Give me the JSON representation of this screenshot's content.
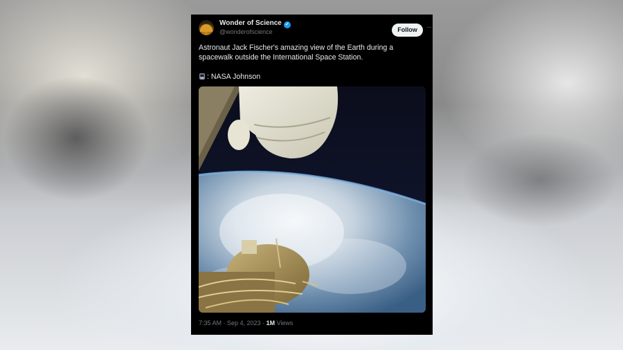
{
  "post": {
    "author_name": "Wonder of Science",
    "author_handle": "@wonderofscience",
    "follow_label": "Follow",
    "more_icon": "ellipsis-icon",
    "verified_icon": "verified-badge-icon",
    "text": "Astronaut Jack Fischer's amazing view of the Earth during a spacewalk outside the International Space Station.",
    "credit_text": ": NASA Johnson",
    "credit_icon": "camera-emoji-icon",
    "timestamp": "7:35 AM · Sep 4, 2023 · ",
    "views_count": "1M",
    "views_label": " Views"
  },
  "colors": {
    "card_background": "#000000",
    "text_primary": "#e7e9ea",
    "text_secondary": "#71767b",
    "verified_blue": "#1d9bf0",
    "follow_button_bg": "#eff3f4"
  }
}
